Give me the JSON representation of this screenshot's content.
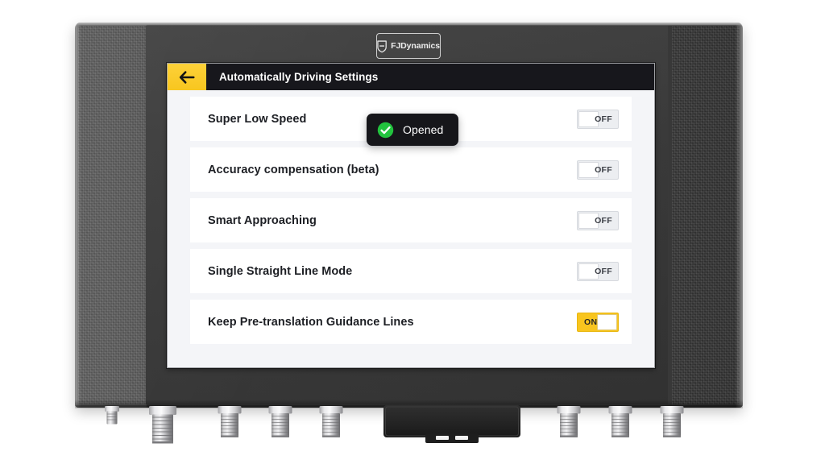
{
  "device": {
    "brand_logo": {
      "icon": "fjdynamics-shield-icon",
      "text": "FJDynamics"
    }
  },
  "screen": {
    "titlebar": {
      "back_icon": "arrow-left-icon",
      "title": "Automatically Driving Settings",
      "bar_color": "#17171c",
      "back_button_color": "#f8c61f"
    },
    "settings": [
      {
        "label": "Super Low Speed",
        "state": "OFF",
        "on": false
      },
      {
        "label": "Accuracy compensation (beta)",
        "state": "OFF",
        "on": false
      },
      {
        "label": "Smart Approaching",
        "state": "OFF",
        "on": false
      },
      {
        "label": "Single Straight Line Mode",
        "state": "OFF",
        "on": false
      },
      {
        "label": "Keep Pre-translation Guidance Lines",
        "state": "ON",
        "on": true
      }
    ],
    "toast": {
      "icon": "check-circle-icon",
      "message": "Opened",
      "background": "#16161a",
      "icon_color": "#22c33e"
    },
    "colors": {
      "page_background": "#f4f5f8",
      "card_background": "#ffffff",
      "toggle_on": "#f8c51e",
      "toggle_off": "#eceef1",
      "accent": "#f8c61f"
    }
  }
}
